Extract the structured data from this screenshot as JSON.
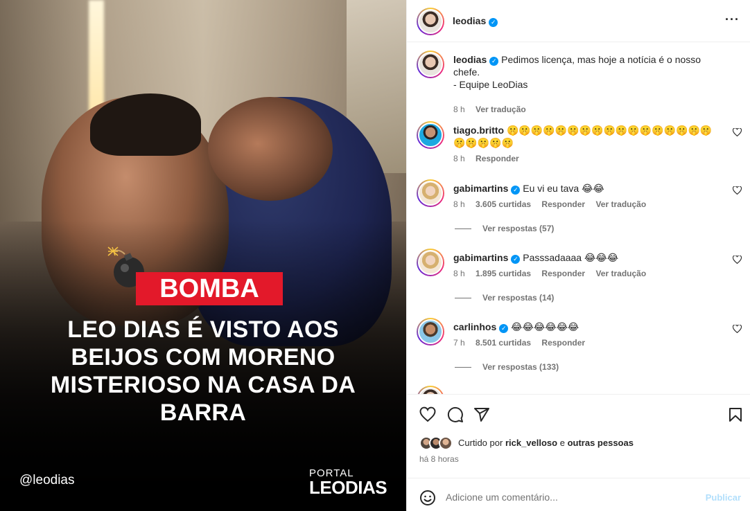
{
  "media": {
    "badge": "BOMBA",
    "headline": "LEO DIAS É VISTO AOS BEIJOS COM MORENO MISTERIOSO NA CASA DA BARRA",
    "handle": "@leodias",
    "brand_top": "PORTAL",
    "brand_bottom": "LEODIAS"
  },
  "header": {
    "username": "leodias",
    "verified": true,
    "more": "···"
  },
  "caption": {
    "username": "leodias",
    "text": "Pedimos licença, mas hoje a notícia é o nosso chefe.",
    "signature": "- Equipe LeoDias",
    "time": "8 h",
    "translate": "Ver tradução"
  },
  "comments": [
    {
      "username": "tiago.britto",
      "verified": false,
      "text": "🤫🤫🤫🤫🤫🤫🤫🤫🤫🤫🤫🤫🤫🤫🤫🤫🤫🤫🤫🤫🤫🤫",
      "time": "8 h",
      "likes": "",
      "reply": "Responder",
      "translate": ""
    },
    {
      "username": "gabimartins",
      "verified": true,
      "text": "Eu vi eu tava 😂😂",
      "time": "8 h",
      "likes": "3.605 curtidas",
      "reply": "Responder",
      "translate": "Ver tradução",
      "replies": "Ver respostas (57)"
    },
    {
      "username": "gabimartins",
      "verified": true,
      "text": "Passsadaaaa 😂😂😂",
      "time": "8 h",
      "likes": "1.895 curtidas",
      "reply": "Responder",
      "translate": "Ver tradução",
      "replies": "Ver respostas (14)"
    },
    {
      "username": "carlinhos",
      "verified": true,
      "text": "😂😂😂😂😂😂",
      "time": "7 h",
      "likes": "8.501 curtidas",
      "reply": "Responder",
      "translate": "",
      "replies": "Ver respostas (133)"
    }
  ],
  "actions": {
    "liked_prefix": "Curtido por",
    "liked_user": "rick_velloso",
    "liked_suffix": "e",
    "liked_others": "outras pessoas",
    "time_ago": "há 8 horas"
  },
  "add_comment": {
    "placeholder": "Adicione um comentário...",
    "publish": "Publicar"
  },
  "colors": {
    "verified": "#0095f6",
    "badge_red": "#e3192a",
    "publish_disabled": "#b2dffc"
  }
}
